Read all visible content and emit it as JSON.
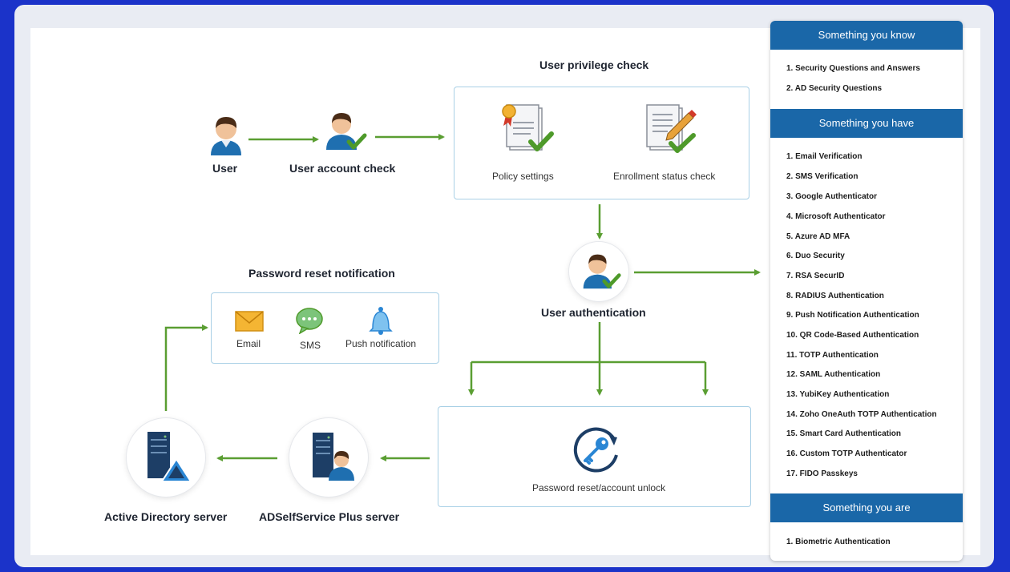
{
  "flow": {
    "user": "User",
    "user_account_check": "User account check",
    "user_privilege_check": "User privilege check",
    "policy_settings": "Policy settings",
    "enrollment_status_check": "Enrollment status check",
    "user_authentication": "User authentication",
    "password_reset_notification": "Password reset notification",
    "email": "Email",
    "sms": "SMS",
    "push_notification": "Push notification",
    "password_reset_account_unlock": "Password reset/account unlock",
    "adselfservice_server": "ADSelfService Plus server",
    "active_directory_server": "Active Directory server"
  },
  "panel": {
    "know": {
      "title": "Something you know",
      "items": [
        "1. Security Questions and Answers",
        "2. AD Security Questions"
      ]
    },
    "have": {
      "title": "Something you have",
      "items": [
        "1. Email Verification",
        "2. SMS Verification",
        "3. Google Authenticator",
        "4. Microsoft Authenticator",
        "5. Azure AD MFA",
        "6. Duo Security",
        "7. RSA SecurID",
        "8. RADIUS Authentication",
        "9. Push Notification Authentication",
        "10. QR Code-Based Authentication",
        "11. TOTP Authentication",
        "12. SAML Authentication",
        "13. YubiKey Authentication",
        "14. Zoho OneAuth TOTP Authentication",
        "15. Smart Card Authentication",
        "16. Custom TOTP Authenticator",
        "17. FIDO Passkeys"
      ]
    },
    "are": {
      "title": "Something you are",
      "items": [
        "1. Biometric Authentication"
      ]
    }
  },
  "colors": {
    "arrow": "#5a9e32",
    "check": "#4e9a2a",
    "header": "#1a67a8",
    "box_border": "#a9d0e6",
    "background": "#1b33c9"
  }
}
